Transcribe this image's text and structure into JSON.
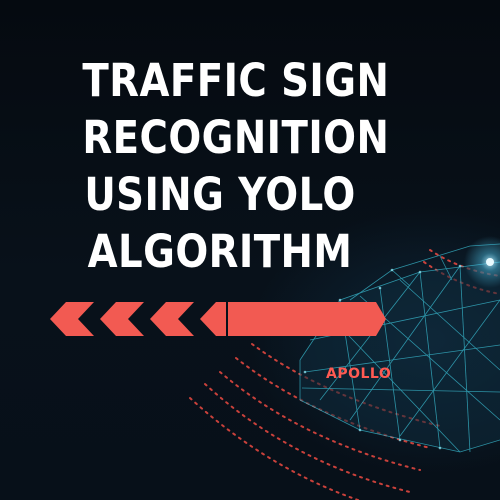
{
  "title": {
    "lines": [
      "TRAFFIC SIGN",
      "RECOGNITION",
      "USING YOLO",
      "ALGORITHM"
    ]
  },
  "brand": {
    "label": "APOLLO"
  },
  "colors": {
    "background": "#060b12",
    "title_text": "#ffffff",
    "accent_red": "#f25a52",
    "wireframe_cyan": "#3fd0e6"
  },
  "icons": {
    "chevron_bar": "chevron-arrow-bar-icon",
    "car": "wireframe-car-icon",
    "sensor_waves": "radar-waves-icon"
  }
}
